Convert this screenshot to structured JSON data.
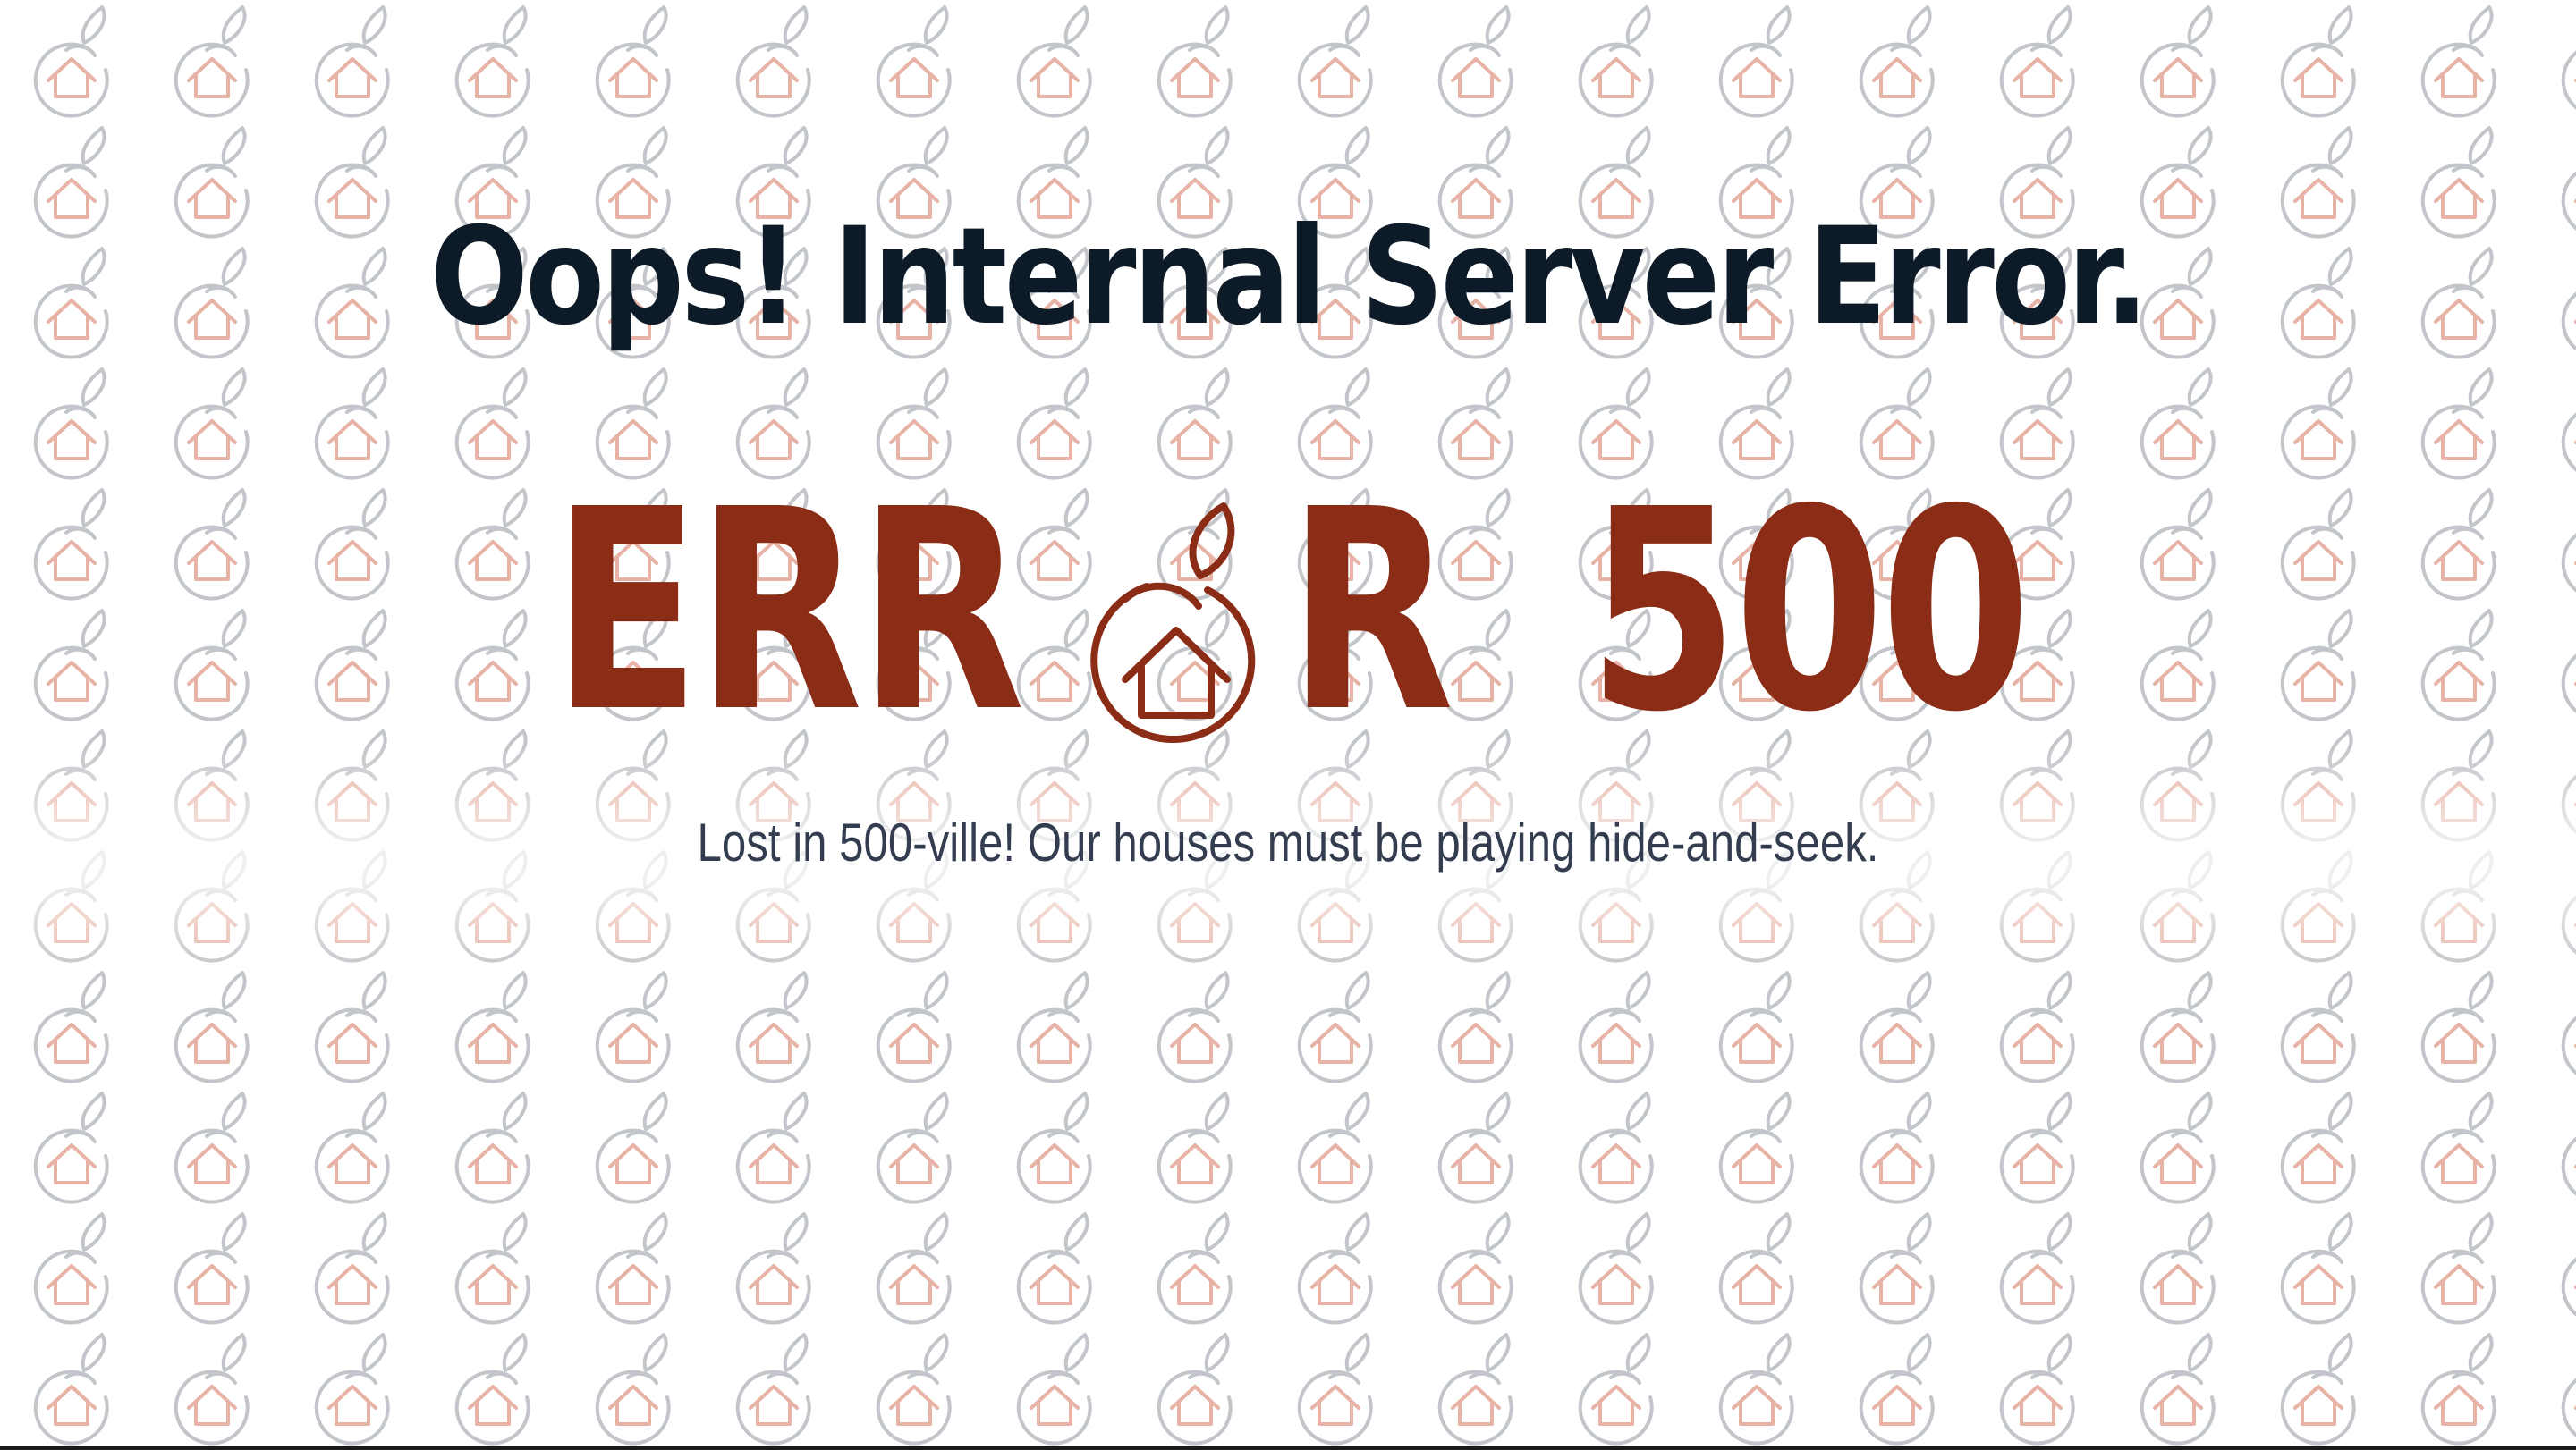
{
  "error_page": {
    "headline": "Oops! Internal Server Error.",
    "code_prefix": "ERR",
    "code_suffix": "R",
    "code_number": "500",
    "logo_icon": "house-in-fruit-icon",
    "message": "Lost in 500-ville! Our houses must be playing hide-and-seek."
  },
  "colors": {
    "background": "#ffffff",
    "headline": "#0c1b27",
    "brand": "#8b2c16",
    "message": "#343d4f",
    "pattern_outline": "#bfc3c8",
    "pattern_house": "#e8b4a8"
  }
}
